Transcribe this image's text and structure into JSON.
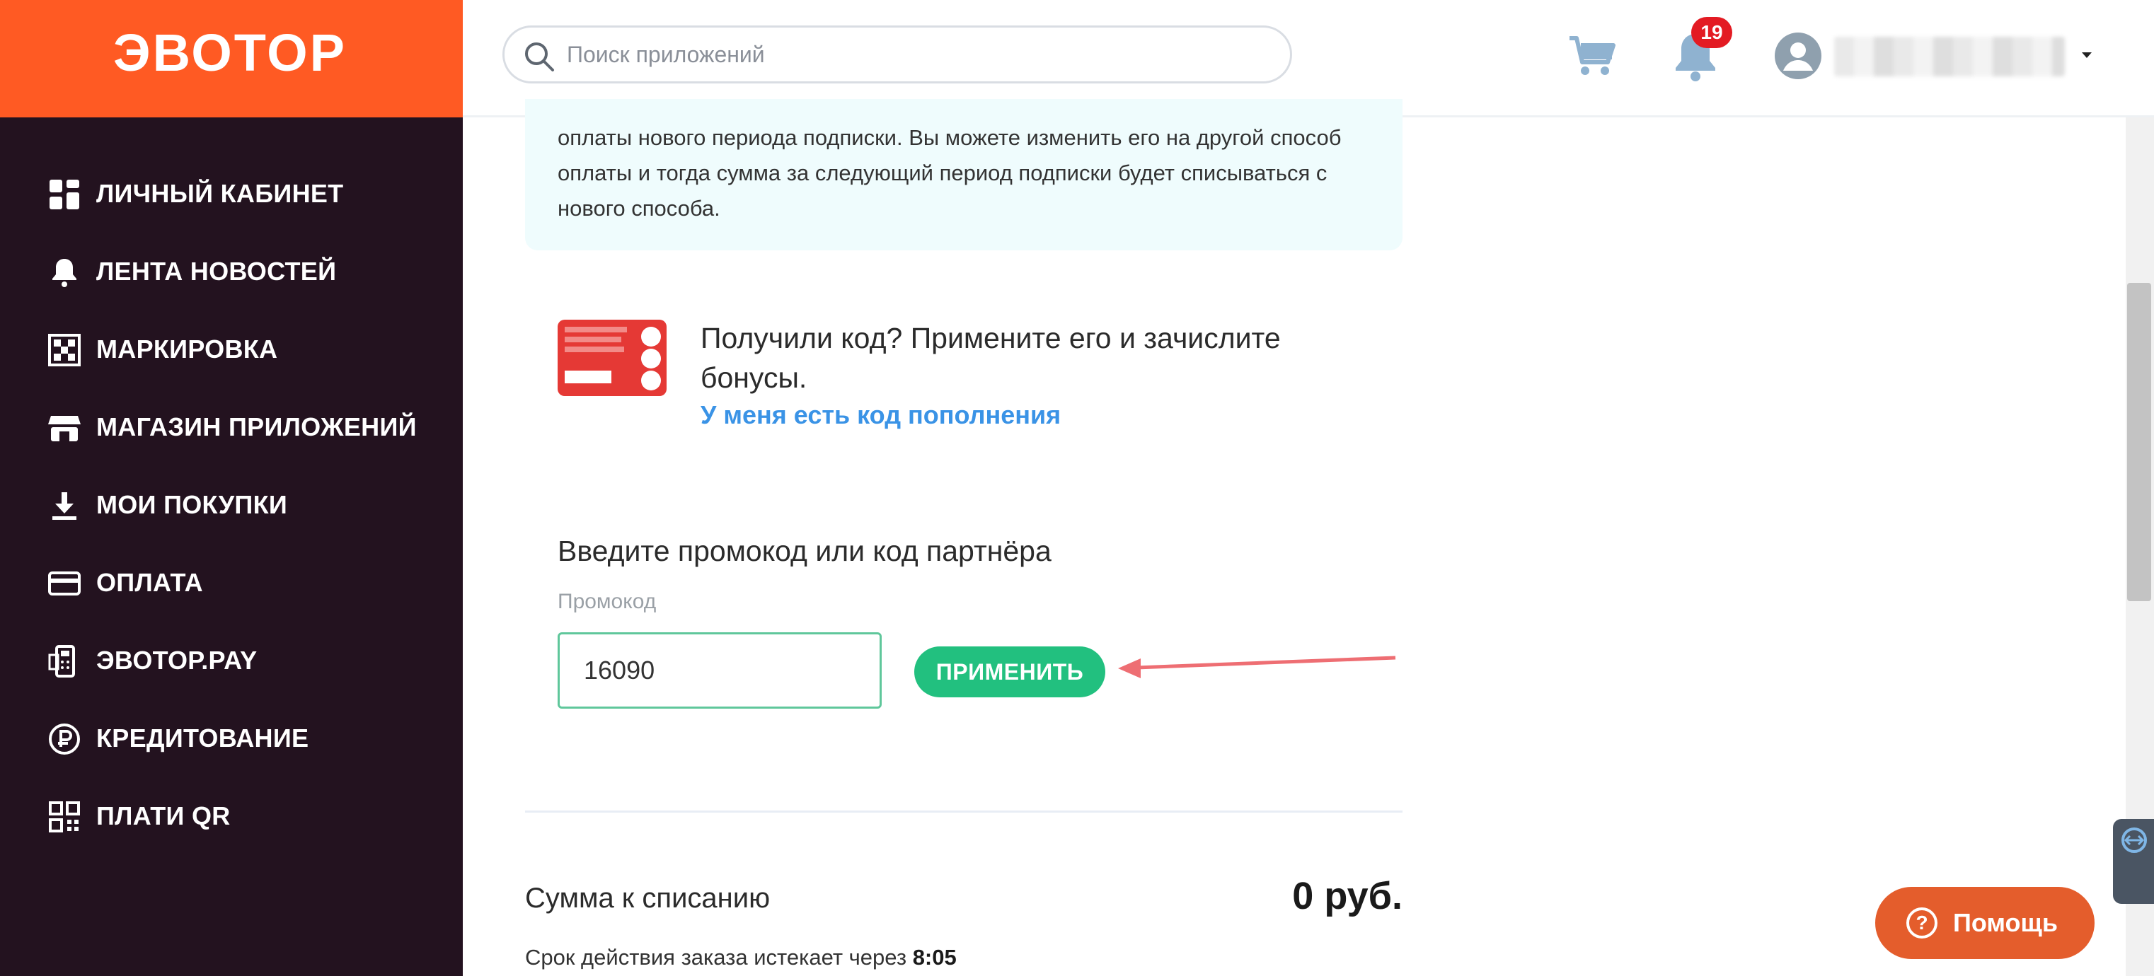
{
  "brand": {
    "logo_text": "ЭВОТОР",
    "color": "#ff5a23",
    "sidebar_bg": "#23121f"
  },
  "sidebar": {
    "items": [
      {
        "label": "ЛИЧНЫЙ КАБИНЕТ",
        "icon": "dashboard-grid-icon"
      },
      {
        "label": "ЛЕНТА НОВОСТЕЙ",
        "icon": "bell-icon"
      },
      {
        "label": "МАРКИРОВКА",
        "icon": "checker-icon"
      },
      {
        "label": "МАГАЗИН ПРИЛОЖЕНИЙ",
        "icon": "store-icon"
      },
      {
        "label": "МОИ ПОКУПКИ",
        "icon": "download-icon"
      },
      {
        "label": "ОПЛАТА",
        "icon": "card-icon"
      },
      {
        "label": "ЭВОТОР.PAY",
        "icon": "terminal-icon"
      },
      {
        "label": "КРЕДИТОВАНИЕ",
        "icon": "ruble-circle-icon"
      },
      {
        "label": "ПЛАТИ QR",
        "icon": "qr-code-icon"
      }
    ]
  },
  "header": {
    "search_placeholder": "Поиск приложений",
    "notifications_count": "19"
  },
  "content": {
    "info_text": "оплаты нового периода подписки. Вы можете изменить его на другой способ оплаты и тогда сумма за следующий период подписки будет списываться с нового способа.",
    "code_title": "Получили код? Примените его и зачислите бонусы.",
    "code_link": "У меня есть код пополнения",
    "promo_heading": "Введите промокод или код партнёра",
    "promo_label": "Промокод",
    "promo_value": "16090",
    "apply_label": "ПРИМЕНИТЬ",
    "total_label": "Сумма к списанию",
    "total_value": "0 руб.",
    "expire_text": "Срок действия заказа истекает через",
    "expire_time": "8:05"
  },
  "help": {
    "label": "Помощь",
    "icon_glyph": "?"
  }
}
